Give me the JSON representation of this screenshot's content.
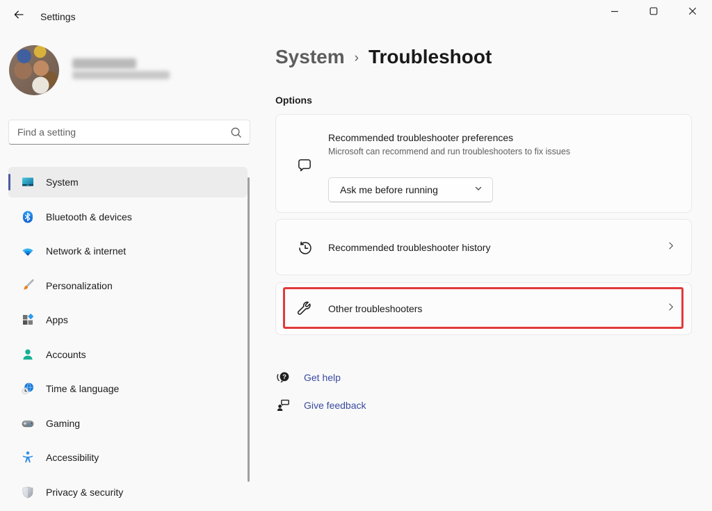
{
  "titlebar": {
    "app_title": "Settings"
  },
  "window_controls": {
    "minimize": "minimize",
    "maximize": "maximize",
    "close": "close"
  },
  "search": {
    "placeholder": "Find a setting"
  },
  "sidebar": {
    "items": [
      {
        "label": "System",
        "icon": "system-icon",
        "selected": true
      },
      {
        "label": "Bluetooth & devices",
        "icon": "bluetooth-icon",
        "selected": false
      },
      {
        "label": "Network & internet",
        "icon": "network-icon",
        "selected": false
      },
      {
        "label": "Personalization",
        "icon": "personalization-icon",
        "selected": false
      },
      {
        "label": "Apps",
        "icon": "apps-icon",
        "selected": false
      },
      {
        "label": "Accounts",
        "icon": "accounts-icon",
        "selected": false
      },
      {
        "label": "Time & language",
        "icon": "time-language-icon",
        "selected": false
      },
      {
        "label": "Gaming",
        "icon": "gaming-icon",
        "selected": false
      },
      {
        "label": "Accessibility",
        "icon": "accessibility-icon",
        "selected": false
      },
      {
        "label": "Privacy & security",
        "icon": "privacy-icon",
        "selected": false
      }
    ]
  },
  "content": {
    "breadcrumb": {
      "parent": "System",
      "separator": "›",
      "current": "Troubleshoot"
    },
    "section_label": "Options",
    "preferences_card": {
      "title": "Recommended troubleshooter preferences",
      "description": "Microsoft can recommend and run troubleshooters to fix issues",
      "dropdown_value": "Ask me before running"
    },
    "history_card": {
      "title": "Recommended troubleshooter history"
    },
    "other_card": {
      "title": "Other troubleshooters",
      "highlighted": true
    },
    "links": {
      "get_help": "Get help",
      "give_feedback": "Give feedback"
    }
  },
  "colors": {
    "accent_pill": "#5059a4",
    "link": "#3b4aa0",
    "highlight_red": "#e23a3a",
    "selected_row_bg": "#ececec"
  }
}
